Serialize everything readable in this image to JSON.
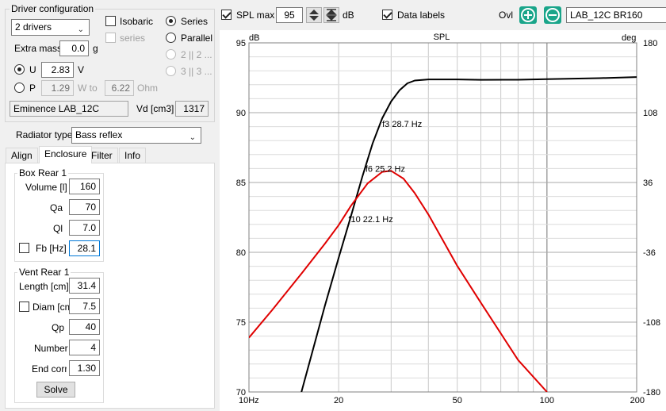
{
  "driver_config": {
    "title": "Driver configuration",
    "drivers_select": "2 drivers",
    "isobaric_label": "Isobaric",
    "series_small_label": "series",
    "series_label": "Series",
    "parallel_label": "Parallel",
    "opt_2x2": "2 || 2 ...",
    "opt_3x3": "3 || 3 ...",
    "extra_mass_label": "Extra mass",
    "extra_mass_value": "0.0",
    "extra_mass_unit": "g",
    "u_label": "U",
    "u_value": "2.83",
    "u_unit": "V",
    "p_label": "P",
    "p_value": "1.29",
    "w_to_label": "W to",
    "ohm_value": "6.22",
    "ohm_unit": "Ohm",
    "driver_name": "Eminence LAB_12C",
    "vd_label": "Vd [cm3]",
    "vd_value": "1317"
  },
  "radiator": {
    "label": "Radiator type",
    "value": "Bass reflex"
  },
  "tabs": [
    {
      "label": "Align"
    },
    {
      "label": "Enclosure"
    },
    {
      "label": "Filter"
    },
    {
      "label": "Info"
    }
  ],
  "box_rear": {
    "title": "Box Rear 1",
    "volume_label": "Volume [l]",
    "volume_value": "160",
    "qa_label": "Qa",
    "qa_value": "70",
    "ql_label": "Ql",
    "ql_value": "7.0",
    "fb_label": "Fb [Hz]",
    "fb_value": "28.1"
  },
  "vent_rear": {
    "title": "Vent Rear 1",
    "length_label": "Length [cm]",
    "length_value": "31.4",
    "diam_label": "Diam [cm]",
    "diam_value": "7.5",
    "qp_label": "Qp",
    "qp_value": "40",
    "number_label": "Number",
    "number_value": "4",
    "endcorr_label": "End corr",
    "endcorr_value": "1.30",
    "solve_label": "Solve"
  },
  "toolbar": {
    "spl_max_label": "SPL max",
    "spl_max_value": "95",
    "spl_unit": "dB",
    "data_labels_label": "Data labels",
    "ovl_label": "Ovl",
    "ovl_value": "LAB_12C BR160"
  },
  "colors": {
    "spl_curve": "#000000",
    "phase_curve": "#e00000",
    "ovl_button": "#1aa58a"
  },
  "chart_data": {
    "type": "line",
    "title": "SPL",
    "xlabel": "",
    "ylabel_left": "dB",
    "ylabel_right": "deg",
    "x_scale": "log",
    "xlim": [
      10,
      200
    ],
    "ylim": [
      70,
      95
    ],
    "y2lim": [
      -180,
      180
    ],
    "x_ticks": [
      {
        "value": 10,
        "label": "10Hz"
      },
      {
        "value": 20,
        "label": "20"
      },
      {
        "value": 50,
        "label": "50"
      },
      {
        "value": 100,
        "label": "100"
      },
      {
        "value": 200,
        "label": "200"
      }
    ],
    "y_ticks": [
      70,
      75,
      80,
      85,
      90,
      95
    ],
    "y2_ticks": [
      -180,
      -108,
      -36,
      36,
      108,
      180
    ],
    "grid": true,
    "series": [
      {
        "axis": "left",
        "color": "#000000",
        "x": [
          15,
          18,
          20,
          22,
          24,
          26,
          28,
          30,
          32,
          34,
          36,
          40,
          45,
          50,
          60,
          80,
          100,
          150,
          200
        ],
        "y": [
          70,
          76.2,
          79.6,
          82.6,
          85.4,
          87.8,
          89.6,
          90.8,
          91.6,
          92.1,
          92.3,
          92.38,
          92.38,
          92.38,
          92.35,
          92.36,
          92.4,
          92.47,
          92.55
        ]
      },
      {
        "axis": "right",
        "color": "#e00000",
        "x": [
          10,
          12,
          15,
          18,
          20,
          22,
          25,
          28,
          30,
          33,
          36,
          40,
          50,
          60,
          80,
          100
        ],
        "y": [
          -124,
          -95,
          -58,
          -27,
          -8,
          12,
          35,
          47,
          48,
          40,
          25,
          3,
          -50,
          -88,
          -147,
          -180
        ]
      }
    ],
    "annotations": [
      {
        "text": "f3 28.7 Hz",
        "x": 28.7,
        "y": 89.2
      },
      {
        "text": "f6 25.2 Hz",
        "x": 25.2,
        "y": 86.0
      },
      {
        "text": "f10 22.1 Hz",
        "x": 22.1,
        "y": 82.4
      }
    ]
  }
}
